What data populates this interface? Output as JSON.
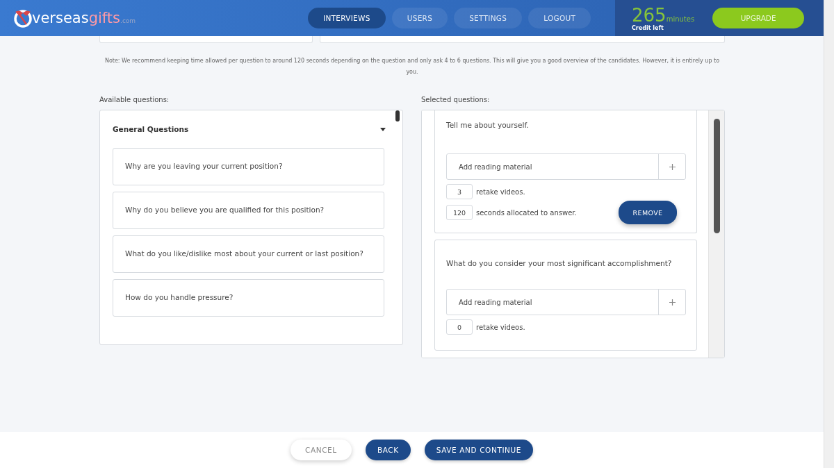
{
  "header": {
    "logo": {
      "main": "verseas",
      "accent": "gifts",
      "suffix": ".com"
    },
    "nav": [
      {
        "label": "INTERVIEWS",
        "selected": true
      },
      {
        "label": "USERS",
        "selected": false
      },
      {
        "label": "SETTINGS",
        "selected": false
      },
      {
        "label": "LOGOUT",
        "selected": false
      }
    ],
    "credit": {
      "amount": "265",
      "unit": "minutes",
      "caption": "Credit left"
    },
    "upgrade_button": "UPGRADE"
  },
  "note": "Note: We recommend keeping time allowed per question to around 120 seconds depending on the question and only ask 4 to 6 questions. This will give you a good overview of the candidates. However, it is entirely up to you.",
  "available": {
    "label": "Available questions:",
    "group": {
      "title": "General Questions",
      "expanded": true,
      "questions": [
        "Why are you leaving your current position?",
        "Why do you believe you are qualified for this position?",
        "What do you like/dislike most about your current or last position?",
        "How do you handle pressure?"
      ]
    }
  },
  "selected": {
    "label": "Selected questions:",
    "questions": [
      {
        "text": "Tell me about yourself.",
        "reading_placeholder": "Add reading material",
        "retakes": "3",
        "retakes_label": "retake videos.",
        "seconds": "120",
        "seconds_label": "seconds allocated to answer.",
        "remove": "REMOVE"
      },
      {
        "text": "What do you consider your most significant accomplishment?",
        "reading_placeholder": "Add reading material",
        "retakes": "0",
        "retakes_label": "retake videos."
      }
    ]
  },
  "footer": [
    {
      "label": "CANCEL",
      "kind": "secondary"
    },
    {
      "label": "BACK",
      "kind": "primary"
    },
    {
      "label": "SAVE AND CONTINUE",
      "kind": "primary"
    }
  ]
}
